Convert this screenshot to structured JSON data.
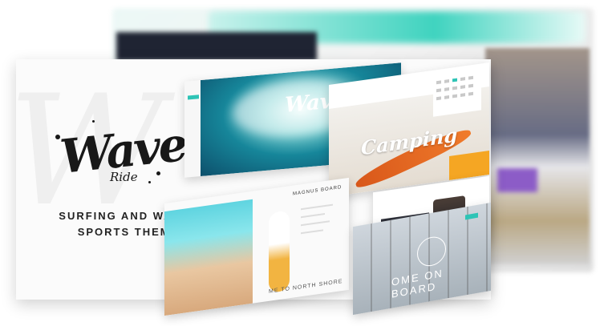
{
  "brand": {
    "logo_word": "Wave",
    "logo_sub": "Ride",
    "tagline_line1": "SURFING AND WATER",
    "tagline_line2": "SPORTS THEME"
  },
  "previews": {
    "hero_title": "Wave",
    "camping_title": "Camping",
    "board_heading": "MAGNUS BOARD",
    "board_footer": "ME TO NORTH SHORE",
    "sailing_title": "OME ON BOARD"
  },
  "colors": {
    "accent": "#2ec4b6",
    "orange": "#f5a623",
    "dark": "#181818"
  }
}
